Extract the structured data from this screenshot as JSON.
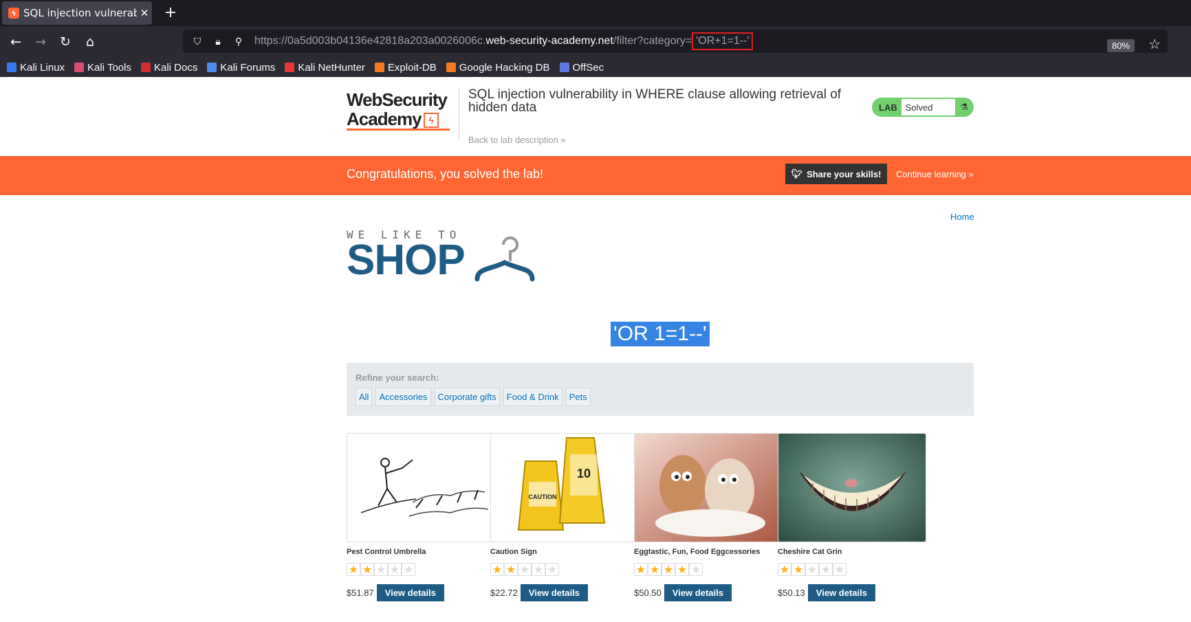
{
  "browser": {
    "tab_title": "SQL injection vulnerability",
    "tab_favicon": "portswigger-icon",
    "new_tab": "+",
    "url_prefix": "https://0a5d003b04136e42818a203a0026006c.",
    "url_domain": "web-security-academy.net",
    "url_path": "/filter?category=",
    "url_payload": "'OR+1=1--'",
    "zoom": "80%",
    "bookmarks": [
      {
        "label": "Kali Linux",
        "color": "#367bf0"
      },
      {
        "label": "Kali Tools",
        "color": "#d94d73"
      },
      {
        "label": "Kali Docs",
        "color": "#d03030"
      },
      {
        "label": "Kali Forums",
        "color": "#4c8de8"
      },
      {
        "label": "Kali NetHunter",
        "color": "#e53935"
      },
      {
        "label": "Exploit-DB",
        "color": "#f57c1f"
      },
      {
        "label": "Google Hacking DB",
        "color": "#f57c1f"
      },
      {
        "label": "OffSec",
        "color": "#5e7ae0"
      }
    ]
  },
  "header": {
    "logo_line1": "WebSecurity",
    "logo_line2": "Academy",
    "lab_title": "SQL injection vulnerability in WHERE clause allowing retrieval of hidden data",
    "back_link": "Back to lab description »",
    "badge_lab": "LAB",
    "badge_status": "Solved"
  },
  "banner": {
    "message": "Congratulations, you solved the lab!",
    "share_label": "Share your skills!",
    "continue_label": "Continue learning »"
  },
  "nav": {
    "home": "Home"
  },
  "shop": {
    "tagline": "WE LIKE TO",
    "title": "SHOP",
    "search_term": "'OR 1=1--'"
  },
  "refine": {
    "label": "Refine your search:",
    "filters": [
      "All",
      "Accessories",
      "Corporate gifts",
      "Food & Drink",
      "Pets"
    ]
  },
  "products": [
    {
      "name": "Pest Control Umbrella",
      "rating": 2,
      "price": "$51.87",
      "button": "View details"
    },
    {
      "name": "Caution Sign",
      "rating": 2,
      "price": "$22.72",
      "button": "View details"
    },
    {
      "name": "Eggtastic, Fun, Food Eggcessories",
      "rating": 4,
      "price": "$50.50",
      "button": "View details"
    },
    {
      "name": "Cheshire Cat Grin",
      "rating": 2,
      "price": "$50.13",
      "button": "View details"
    }
  ],
  "colors": {
    "accent_orange": "#ff6633",
    "shop_blue": "#1f5c85",
    "solved_green": "#70d16d",
    "star_gold": "#fbb21c",
    "url_box_red": "#e0201d"
  }
}
